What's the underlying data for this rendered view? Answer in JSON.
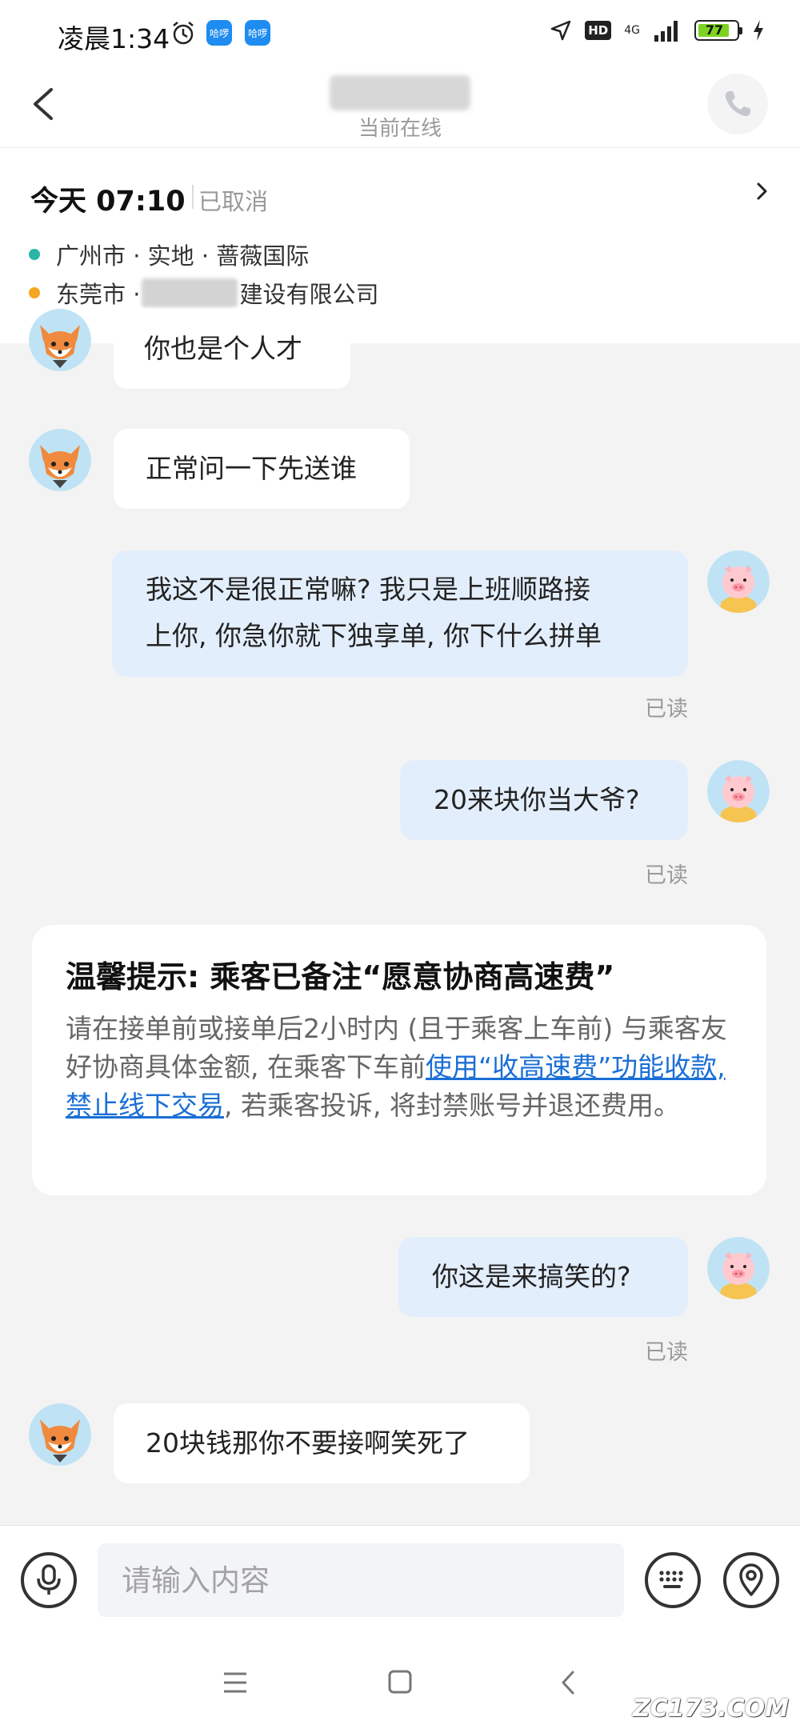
{
  "status_bar": {
    "time": "凌晨1:34",
    "app_badge_1": "哈啰",
    "app_badge_2": "哈啰",
    "hd": "HD",
    "network": "4G",
    "battery": "77"
  },
  "header": {
    "presence": "当前在线"
  },
  "trip": {
    "date": "今天 07:10",
    "status": "已取消",
    "from": "广州市 · 实地 · 蔷薇国际",
    "to_prefix": "东莞市 · ",
    "to_suffix": "建设有限公司",
    "colors": {
      "from_dot": "#2bb5a8",
      "to_dot": "#f5a623"
    }
  },
  "messages": [
    {
      "side": "in",
      "text": "你也是个人才"
    },
    {
      "side": "in",
      "text": "正常问一下先送谁"
    },
    {
      "side": "out",
      "text": "我这不是很正常嘛? 我只是上班顺路接上你, 你急你就下独享单, 你下什么拼单",
      "line1": "我这不是很正常嘛? 我只是上班顺路接",
      "line2": "上你, 你急你就下独享单, 你下什么拼单",
      "status": "已读"
    },
    {
      "side": "out",
      "text": "20来块你当大爷?",
      "status": "已读"
    },
    {
      "side": "out",
      "text": "你这是来搞笑的?",
      "status": "已读"
    },
    {
      "side": "in",
      "text": "20块钱那你不要接啊笑死了"
    }
  ],
  "notice": {
    "title": "温馨提示: 乘客已备注“愿意协商高速费”",
    "body_pre": "请在接单前或接单后2小时内 (且于乘客上车前) 与乘客友好协商具体金额, 在乘客下车前",
    "body_link": "使用“收高速费”功能收款, 禁止线下交易",
    "body_post": ", 若乘客投诉, 将封禁账号并退还费用。"
  },
  "input": {
    "placeholder": "请输入内容"
  },
  "watermark": "ZC173.COM",
  "icons": [
    "back-arrow-icon",
    "phone-icon",
    "chevron-right-icon",
    "microphone-icon",
    "keyboard-icon",
    "location-icon",
    "menu-icon",
    "home-icon",
    "back-nav-icon"
  ],
  "colors": {
    "accent_link": "#1a6fd6",
    "out_bubble": "#e3eefc",
    "in_bubble": "#ffffff"
  }
}
